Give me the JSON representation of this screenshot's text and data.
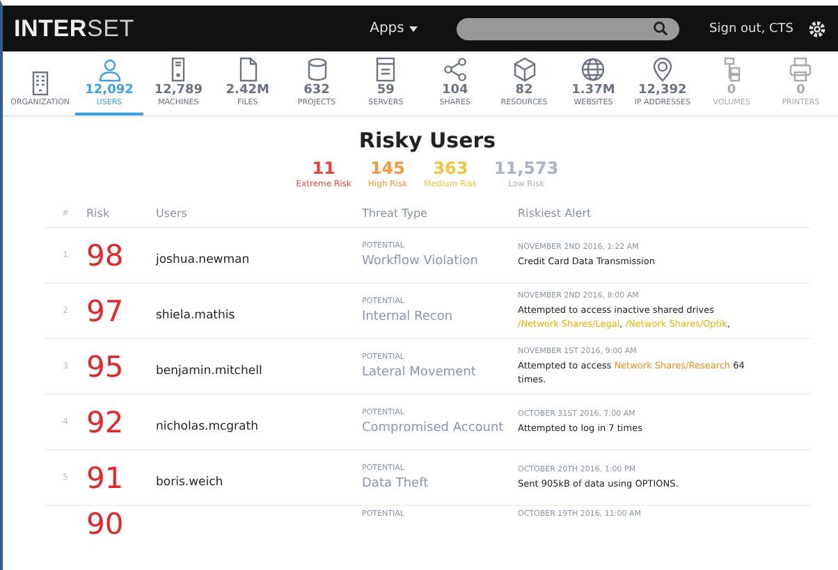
{
  "topbar": {
    "logo_bold": "INTER",
    "logo_light": "SET",
    "apps_menu": "Apps",
    "sign_out": "Sign out, CTS"
  },
  "nav": [
    {
      "label": "ORGANIZATION",
      "selected": false,
      "disabled": false
    },
    {
      "label": "USERS",
      "count": "12,092",
      "selected": true,
      "disabled": false
    },
    {
      "label": "MACHINES",
      "count": "12,789",
      "selected": false,
      "disabled": false
    },
    {
      "label": "FILES",
      "count": "2.42M",
      "selected": false,
      "disabled": false
    },
    {
      "label": "PROJECTS",
      "count": "632",
      "selected": false,
      "disabled": false
    },
    {
      "label": "SERVERS",
      "count": "59",
      "selected": false,
      "disabled": false
    },
    {
      "label": "SHARES",
      "count": "104",
      "selected": false,
      "disabled": false
    },
    {
      "label": "RESOURCES",
      "count": "82",
      "selected": false,
      "disabled": false
    },
    {
      "label": "WEBSITES",
      "count": "1.37M",
      "selected": false,
      "disabled": false
    },
    {
      "label": "IP ADDRESSES",
      "count": "12,392",
      "selected": false,
      "disabled": false
    },
    {
      "label": "VOLUMES",
      "count": "0",
      "selected": false,
      "disabled": true
    },
    {
      "label": "PRINTERS",
      "count": "0",
      "selected": false,
      "disabled": true
    }
  ],
  "title": "Risky Users",
  "stats": [
    {
      "value": "11",
      "label": "Extreme Risk",
      "color": "#e8433f"
    },
    {
      "value": "145",
      "label": "High Risk",
      "color": "#f5973b"
    },
    {
      "value": "363",
      "label": "Medium Risk",
      "color": "#eec53a"
    },
    {
      "value": "11,573",
      "label": "Low Risk",
      "color": "#a9b3c4"
    }
  ],
  "table": {
    "columns": [
      "#",
      "Risk",
      "Users",
      "Threat Type",
      "Riskiest Alert"
    ],
    "rows": [
      {
        "rank": "1",
        "risk": "98",
        "user": "joshua.newman",
        "qualifier": "POTENTIAL",
        "threat": "Workflow Violation",
        "date": "NOVEMBER 2ND 2016, 1:22 AM",
        "alert": [
          {
            "text": "Credit Card Data Transmission"
          }
        ]
      },
      {
        "rank": "2",
        "risk": "97",
        "user": "shiela.mathis",
        "qualifier": "POTENTIAL",
        "threat": "Internal Recon",
        "date": "NOVEMBER 2ND 2016, 8:00 AM",
        "alert": [
          {
            "text": "Attempted to access inactive shared drives "
          },
          {
            "text": "/Network Shares/Legal",
            "color": "#e8b400"
          },
          {
            "text": ", "
          },
          {
            "text": "/Network Shares/Optik",
            "color": "#e8b400"
          },
          {
            "text": ","
          }
        ]
      },
      {
        "rank": "3",
        "risk": "95",
        "user": "benjamin.mitchell",
        "qualifier": "POTENTIAL",
        "threat": "Lateral Movement",
        "date": "NOVEMBER 1ST 2016, 9:00 AM",
        "alert": [
          {
            "text": "Attempted to access "
          },
          {
            "text": "Network Shares/Research",
            "color": "#f28a1c"
          },
          {
            "text": " 64 times."
          }
        ]
      },
      {
        "rank": "4",
        "risk": "92",
        "user": "nicholas.mcgrath",
        "qualifier": "POTENTIAL",
        "threat": "Compromised Account",
        "date": "OCTOBER 31ST 2016, 7:00 AM",
        "alert": [
          {
            "text": "Attempted to log in 7 times"
          }
        ]
      },
      {
        "rank": "5",
        "risk": "91",
        "user": "boris.weich",
        "qualifier": "POTENTIAL",
        "threat": "Data Theft",
        "date": "OCTOBER 20TH 2016, 1:00 PM",
        "alert": [
          {
            "text": "Sent 905kB of data using OPTIONS."
          }
        ]
      },
      {
        "risk": "90",
        "qualifier": "POTENTIAL",
        "date": "OCTOBER 19TH 2016, 11:00 AM"
      }
    ]
  }
}
